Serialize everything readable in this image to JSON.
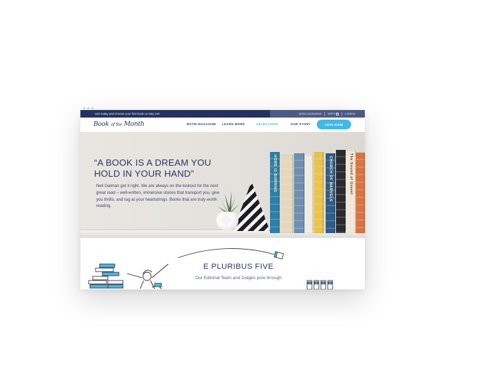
{
  "topbar": {
    "promo": "Join today and choose your first book on May 1st!",
    "links": [
      "DISCUSSIONS",
      "GIFT",
      "LOGIN"
    ]
  },
  "nav": {
    "logo_a": "Book",
    "logo_b": "of the",
    "logo_c": "Month",
    "links": [
      "BOTM MAGAZINE",
      "LEARN MORE",
      "SELECTIONS",
      "OUR STORY"
    ],
    "active_link": "SELECTIONS",
    "cta": "JOIN NOW"
  },
  "hero": {
    "quote_line1": "“A BOOK IS A DREAM YOU",
    "quote_line2": "HOLD IN YOUR HAND”",
    "blurb": "Neil Gaiman got it right. We are always on the lookout for the next great read – well-written, immersive stories that transport you, give you thrills, and tug at your heartstrings. Books that are truly worth reading.",
    "books": [
      {
        "title": "HOME IS BURNING",
        "color": "#2b7fa8",
        "text": "#f3e9c9"
      },
      {
        "title": "",
        "color": "#e4d7bf",
        "text": "#3a3a3a"
      },
      {
        "title": "",
        "color": "#6d8fb0",
        "text": "#fff7e0"
      },
      {
        "title": "",
        "color": "#f1ece2",
        "text": "#1f3c66"
      },
      {
        "title": "",
        "color": "#e8c24a",
        "text": "#263c6e"
      },
      {
        "title": "CHURCH OF MARVELS",
        "color": "#2e5d86",
        "text": "#ffe9b8"
      },
      {
        "title": "",
        "color": "#2b2b2f",
        "text": "#f2f2f2"
      },
      {
        "title": "The Sound of Gravel",
        "color": "#efe7d8",
        "text": "#7a3c1e"
      },
      {
        "title": "",
        "color": "#d9733f",
        "text": "#ffffff"
      }
    ]
  },
  "lower": {
    "title": "E PLURIBUS FIVE",
    "subtitle": "Our Editorial Team and Judges pore through"
  }
}
